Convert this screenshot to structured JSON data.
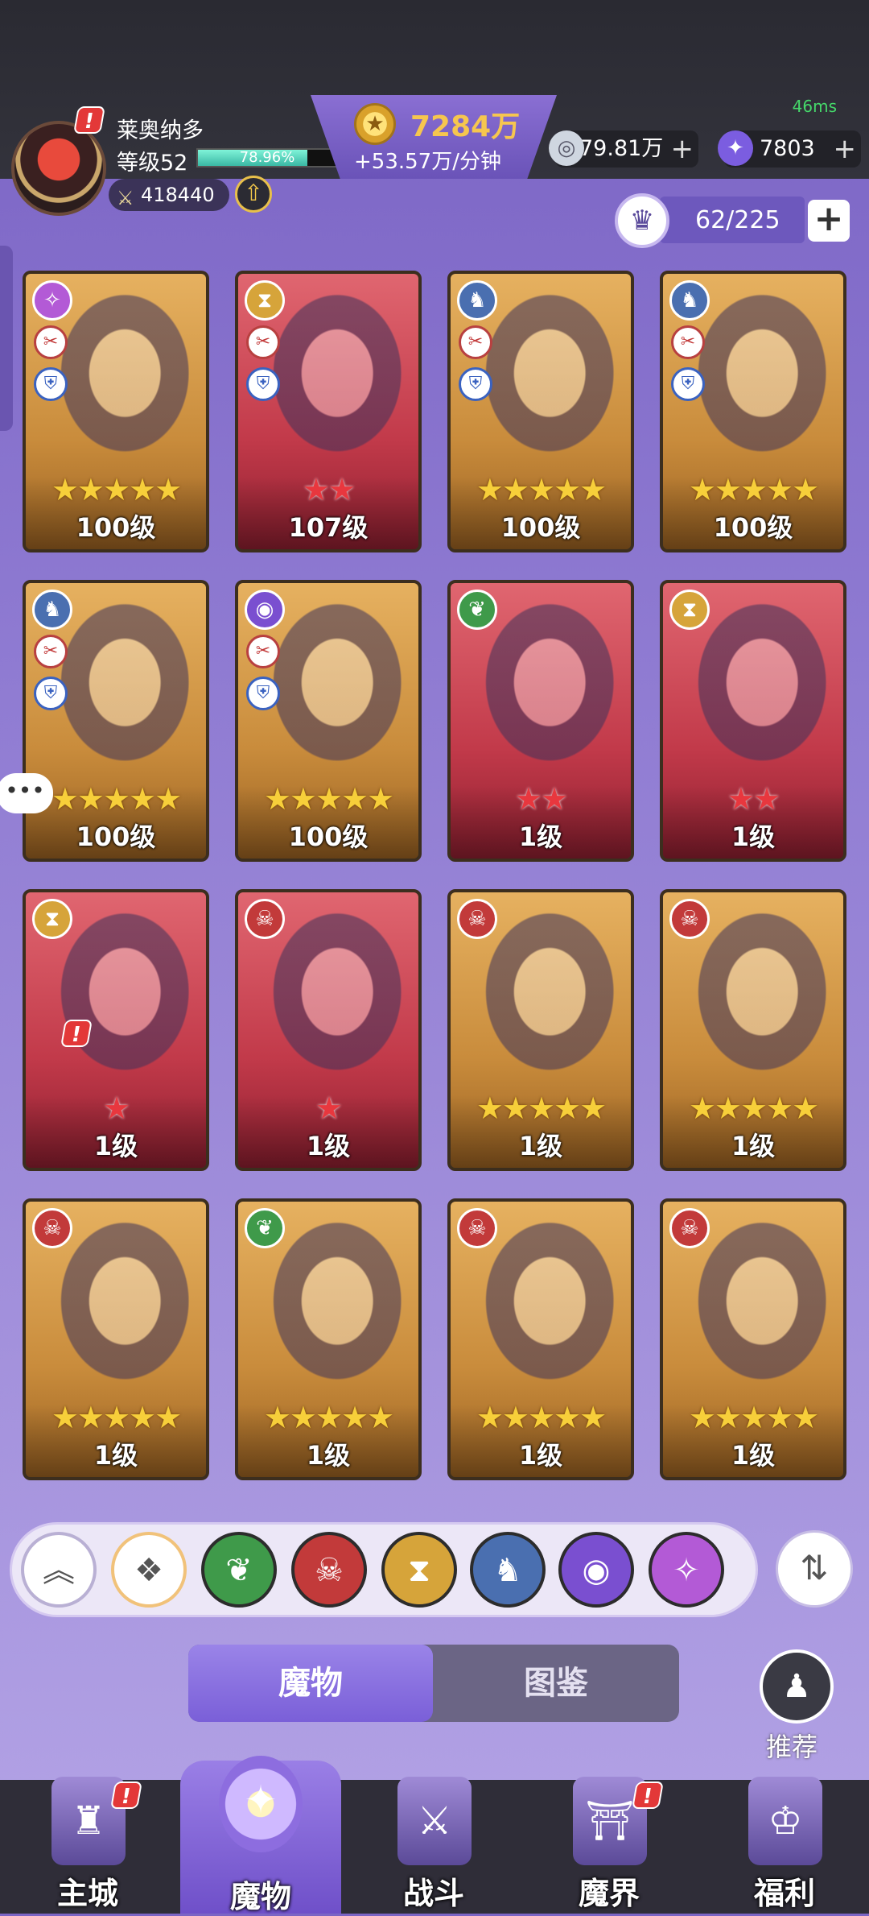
{
  "header": {
    "ping": "46ms",
    "player_name": "莱奥纳多",
    "level_text": "等级52",
    "exp_percent": "78.96%",
    "exp_fraction": 0.7896,
    "power": "418440",
    "gold": "7284万",
    "gold_rate": "+53.57万/分钟",
    "silver": "79.81万",
    "gems": "7803",
    "capacity": "62/225"
  },
  "cards": [
    {
      "level": "100级",
      "stars": "★★★★★",
      "star_color": "gold",
      "frame": "gold",
      "faction_icon": "diamond-swirl-icon"
    },
    {
      "level": "107级",
      "stars": "★★",
      "star_color": "red",
      "frame": "red",
      "faction_icon": "hourglass-icon"
    },
    {
      "level": "100级",
      "stars": "★★★★★",
      "star_color": "gold",
      "frame": "gold",
      "faction_icon": "dragon-icon"
    },
    {
      "level": "100级",
      "stars": "★★★★★",
      "star_color": "gold",
      "frame": "gold",
      "faction_icon": "dragon-icon"
    },
    {
      "level": "100级",
      "stars": "★★★★★",
      "star_color": "gold",
      "frame": "gold",
      "faction_icon": "dragon-icon"
    },
    {
      "level": "100级",
      "stars": "★★★★★",
      "star_color": "gold",
      "frame": "gold",
      "faction_icon": "eye-icon"
    },
    {
      "level": "1级",
      "stars": "★★",
      "star_color": "red",
      "frame": "red",
      "faction_icon": "leaf-icon"
    },
    {
      "level": "1级",
      "stars": "★★",
      "star_color": "red",
      "frame": "red",
      "faction_icon": "hourglass-icon"
    },
    {
      "level": "1级",
      "stars": "★",
      "star_color": "red",
      "frame": "red",
      "faction_icon": "hourglass-icon"
    },
    {
      "level": "1级",
      "stars": "★",
      "star_color": "red",
      "frame": "red",
      "faction_icon": "demon-mask-icon"
    },
    {
      "level": "1级",
      "stars": "★★★★★",
      "star_color": "gold",
      "frame": "gold",
      "faction_icon": "demon-mask-icon"
    },
    {
      "level": "1级",
      "stars": "★★★★★",
      "star_color": "gold",
      "frame": "gold",
      "faction_icon": "demon-mask-icon"
    },
    {
      "level": "1级",
      "stars": "★★★★★",
      "star_color": "gold",
      "frame": "gold",
      "faction_icon": "demon-mask-icon"
    },
    {
      "level": "1级",
      "stars": "★★★★★",
      "star_color": "gold",
      "frame": "gold",
      "faction_icon": "leaf-icon"
    },
    {
      "level": "1级",
      "stars": "★★★★★",
      "star_color": "gold",
      "frame": "gold",
      "faction_icon": "demon-mask-icon"
    },
    {
      "level": "1级",
      "stars": "★★★★★",
      "star_color": "gold",
      "frame": "gold",
      "faction_icon": "demon-mask-icon"
    }
  ],
  "filters": [
    {
      "name": "collapse-filter-button",
      "icon": "chevrons-up-icon",
      "glyph": "︽"
    },
    {
      "name": "all-filter-button",
      "icon": "diamond-grid-icon",
      "glyph": "❖"
    },
    {
      "name": "nature-filter-button",
      "icon": "leaf-icon",
      "glyph": "❦"
    },
    {
      "name": "demon-filter-button",
      "icon": "demon-mask-icon",
      "glyph": "☠"
    },
    {
      "name": "time-filter-button",
      "icon": "hourglass-icon",
      "glyph": "⧗"
    },
    {
      "name": "dragon-filter-button",
      "icon": "dragon-icon",
      "glyph": "♞"
    },
    {
      "name": "eye-filter-button",
      "icon": "eye-icon",
      "glyph": "◉"
    },
    {
      "name": "arcane-filter-button",
      "icon": "diamond-swirl-icon",
      "glyph": "✧"
    }
  ],
  "tabs": {
    "monsters": "魔物",
    "codex": "图鉴"
  },
  "recommend_label": "推荐",
  "nav": {
    "city": "主城",
    "monsters": "魔物",
    "battle": "战斗",
    "realm": "魔界",
    "welfare": "福利"
  },
  "colors": {
    "gold_text": "#f6c64e",
    "ping_green": "#45d86a",
    "star_gold": "#f7cf3a",
    "star_red": "#e8373e"
  }
}
